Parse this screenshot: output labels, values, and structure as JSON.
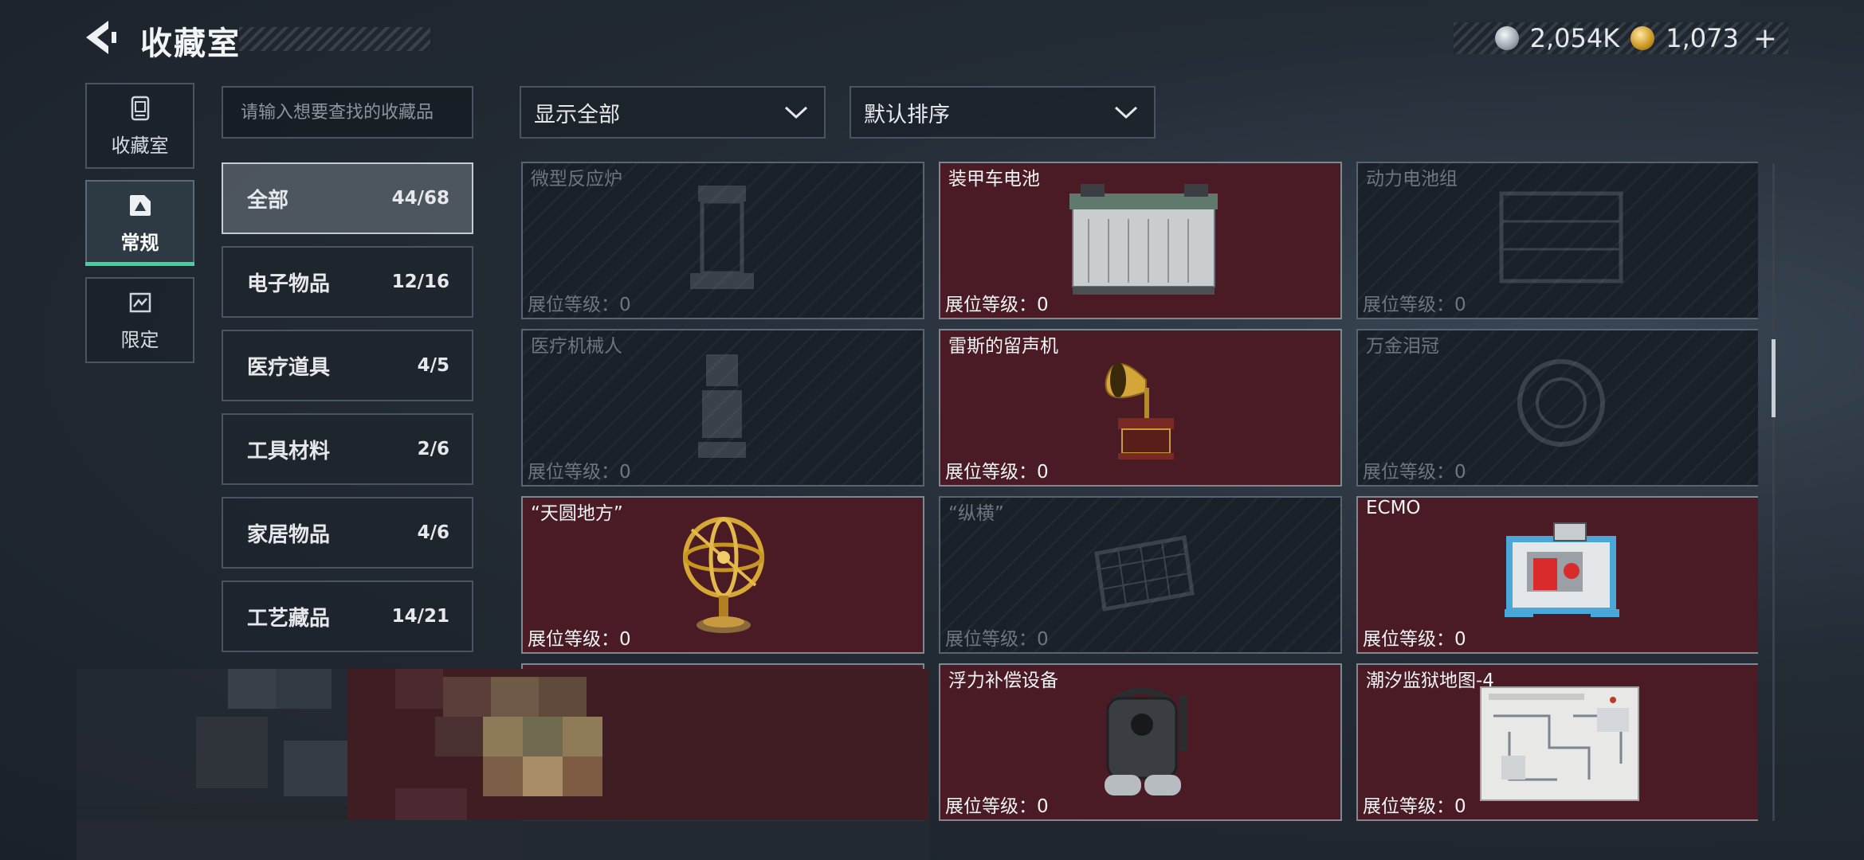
{
  "header": {
    "title": "收藏室"
  },
  "currency": {
    "silver_amount": "2,054K",
    "gold_amount": "1,073",
    "plus_label": "+"
  },
  "sidebar": {
    "tabs": [
      {
        "label": "收藏室",
        "icon": "collection-icon"
      },
      {
        "label": "常规",
        "icon": "regular-icon",
        "active": true
      },
      {
        "label": "限定",
        "icon": "limited-icon"
      }
    ]
  },
  "search": {
    "placeholder": "请输入想要查找的收藏品"
  },
  "categories": [
    {
      "label": "全部",
      "count": "44/68",
      "active": true
    },
    {
      "label": "电子物品",
      "count": "12/16"
    },
    {
      "label": "医疗道具",
      "count": "4/5"
    },
    {
      "label": "工具材料",
      "count": "2/6"
    },
    {
      "label": "家居物品",
      "count": "4/6"
    },
    {
      "label": "工艺藏品",
      "count": "14/21"
    }
  ],
  "filters": {
    "display_filter": "显示全部",
    "sort_order": "默认排序"
  },
  "level_label": "展位等级：0",
  "items": [
    {
      "name": "微型反应炉",
      "owned": false,
      "icon": "reactor-icon"
    },
    {
      "name": "装甲车电池",
      "owned": true,
      "icon": "battery-icon"
    },
    {
      "name": "动力电池组",
      "owned": false,
      "icon": "battery-pack-icon"
    },
    {
      "name": "医疗机械人",
      "owned": false,
      "icon": "robot-icon"
    },
    {
      "name": "雷斯的留声机",
      "owned": true,
      "icon": "gramophone-icon"
    },
    {
      "name": "万金泪冠",
      "owned": false,
      "icon": "crown-icon"
    },
    {
      "name": "“天圆地方”",
      "owned": true,
      "icon": "armillary-sphere-icon"
    },
    {
      "name": "“纵横”",
      "owned": false,
      "icon": "chessboard-icon"
    },
    {
      "name": "ECMO",
      "owned": true,
      "icon": "ecmo-machine-icon"
    },
    {
      "name": "",
      "owned": true,
      "icon": "blurred-item-icon"
    },
    {
      "name": "浮力补偿设备",
      "owned": true,
      "icon": "buoyancy-device-icon"
    },
    {
      "name": "潮汐监狱地图-4",
      "owned": true,
      "icon": "map-icon"
    }
  ]
}
